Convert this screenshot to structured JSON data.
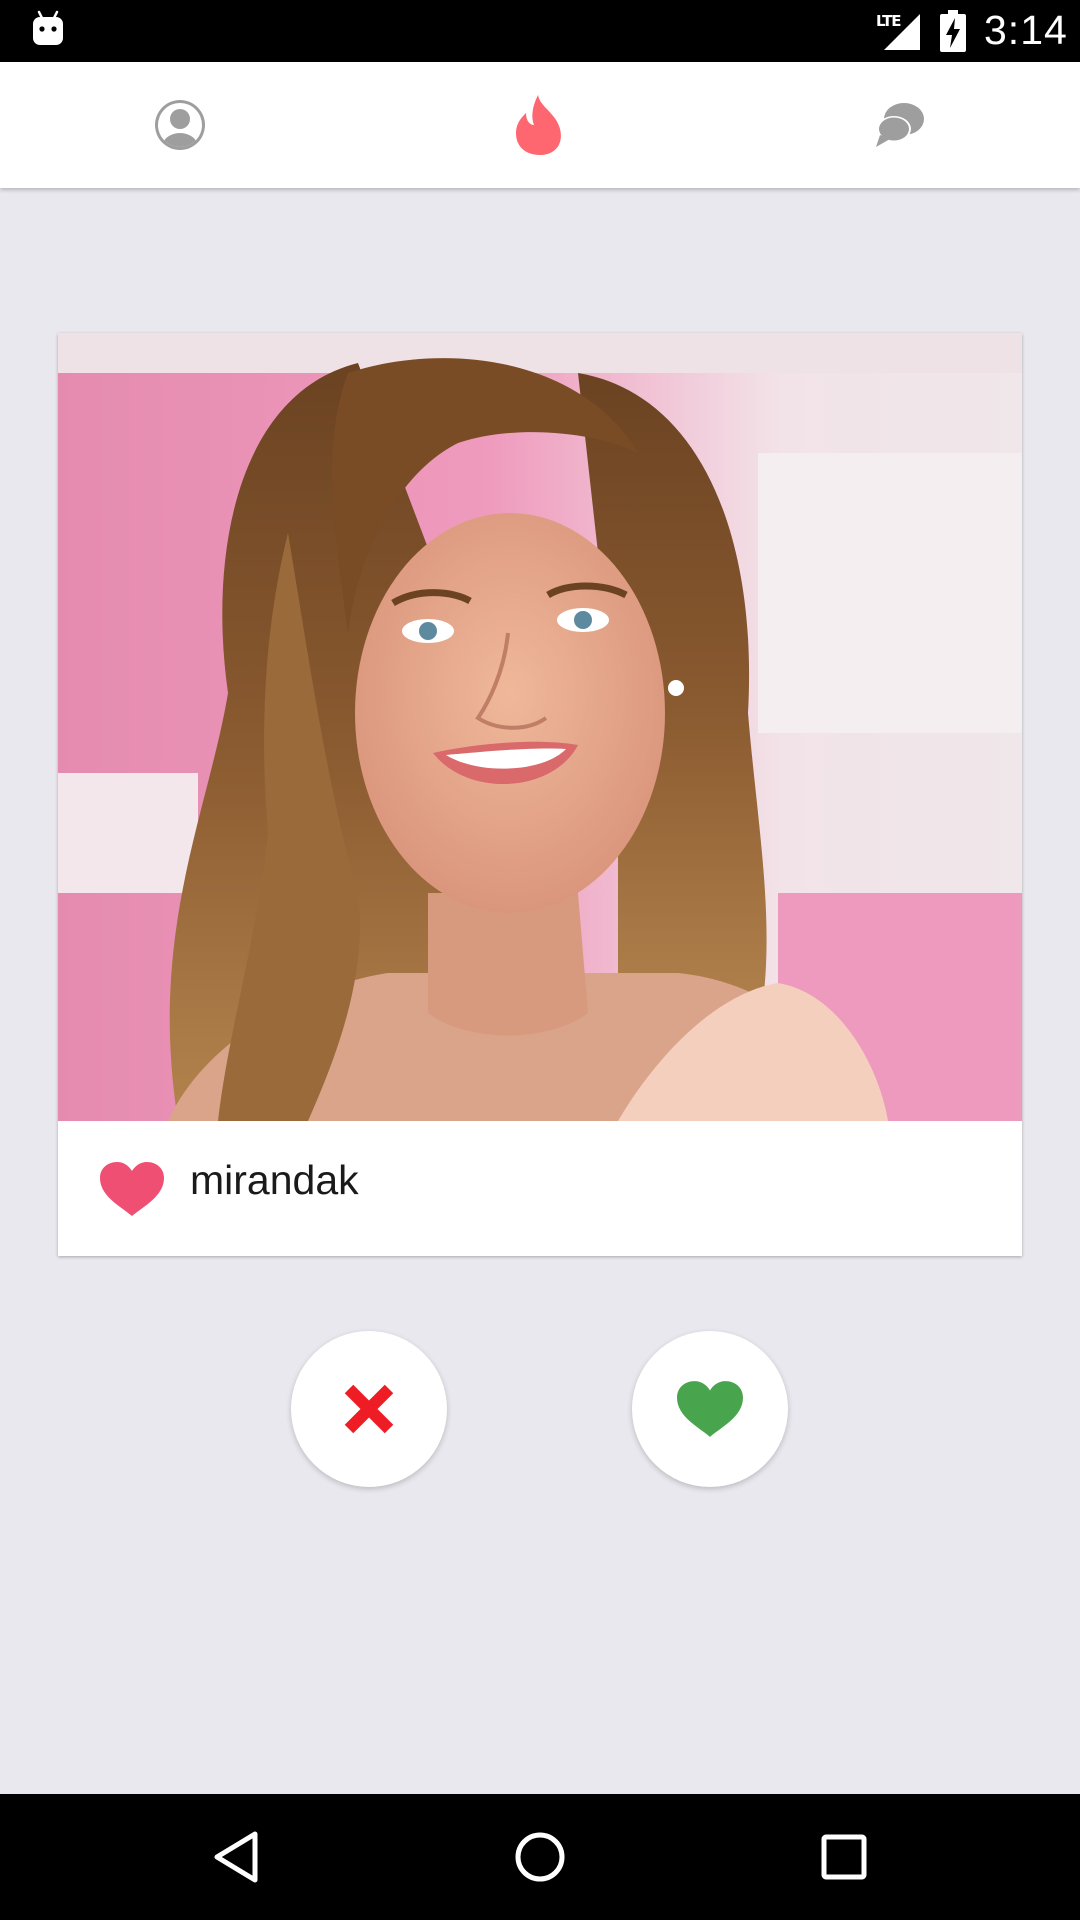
{
  "status_bar": {
    "time": "3:14",
    "network": "LTE",
    "icons": [
      "android-notification-icon",
      "signal-icon",
      "battery-charging-icon"
    ]
  },
  "top_tabs": [
    {
      "name": "profile",
      "icon": "person-icon",
      "active": false
    },
    {
      "name": "discover",
      "icon": "flame-icon",
      "active": true
    },
    {
      "name": "messages",
      "icon": "chat-bubbles-icon",
      "active": false
    }
  ],
  "card": {
    "username": "mirandak",
    "photo_icon": "profile-photo",
    "like_icon": "heart-icon"
  },
  "actions": {
    "nope_icon": "close-icon",
    "like_icon": "heart-icon"
  },
  "nav_bar": {
    "icons": [
      "back-icon",
      "home-icon",
      "recents-icon"
    ]
  },
  "colors": {
    "background": "#e9e8ee",
    "flame": "#fe6670",
    "card_heart": "#ef4f72",
    "nope_red": "#ee1c24",
    "like_green": "#48a54d",
    "inactive_icon": "#9e9e9e"
  }
}
